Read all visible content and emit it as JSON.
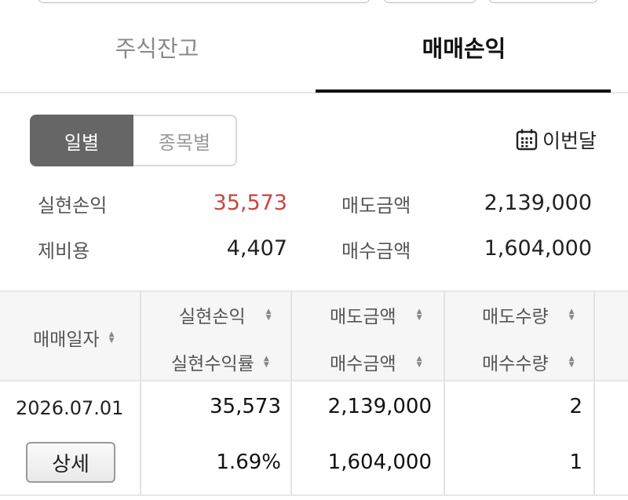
{
  "tabs": [
    {
      "label": "주식잔고",
      "active": false
    },
    {
      "label": "매매손익",
      "active": true
    }
  ],
  "segment": {
    "daily": "일별",
    "by_stock": "종목별"
  },
  "period": {
    "label": "이번달",
    "icon": "calendar-icon"
  },
  "summary": {
    "realized_pl_label": "실현손익",
    "realized_pl_value": "35,573",
    "fees_label": "제비용",
    "fees_value": "4,407",
    "sell_amount_label": "매도금액",
    "sell_amount_value": "2,139,000",
    "buy_amount_label": "매수금액",
    "buy_amount_value": "1,604,000"
  },
  "table": {
    "headers": {
      "trade_date": "매매일자",
      "realized_pl": "실현손익",
      "realized_rate": "실현수익률",
      "sell_amount": "매도금액",
      "buy_amount": "매수금액",
      "sell_qty": "매도수량",
      "buy_qty": "매수수량"
    },
    "rows": [
      {
        "date": "2026.07.01",
        "detail_label": "상세",
        "realized_pl": "35,573",
        "realized_rate": "1.69%",
        "sell_amount": "2,139,000",
        "buy_amount": "1,604,000",
        "sell_qty": "2",
        "buy_qty": "1"
      }
    ]
  },
  "colors": {
    "profit": "#c8463f",
    "active_segment": "#666666"
  }
}
